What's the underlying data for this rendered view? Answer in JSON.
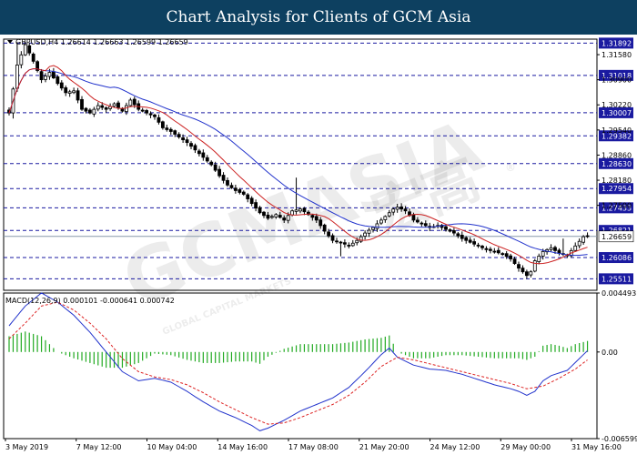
{
  "title": "Chart Analysis for Clients of GCM Asia",
  "watermark": {
    "main": "GCMASIA",
    "tag": "GLOBAL CAPITAL MARKETS",
    "chinese": "宏高",
    "trade": "®"
  },
  "colors": {
    "banner": "#0d4060",
    "candle": "#000000",
    "ma_fast": "#cc2222",
    "ma_slow": "#2233cc",
    "support_resistance": "#1a1aa0",
    "current_price_line": "#8899aa",
    "macd_hist": "#22aa22",
    "macd_main": "#2233cc",
    "macd_signal": "#dd2222"
  },
  "chart_data": [
    {
      "type": "candlestick",
      "info": "GBPUSD,H4  1.26614 1.26663 1.26599 1.26659",
      "ylim": [
        1.252,
        1.32
      ],
      "y_ticks": [
        "1.31892",
        "1.31580",
        "1.30900",
        "1.31018",
        "1.30220",
        "1.30007",
        "1.29540",
        "1.29382",
        "1.28860",
        "1.28630",
        "1.28180",
        "1.27954",
        "1.27500",
        "1.27433",
        "1.26821",
        "1.26659",
        "1.26086",
        "1.25511"
      ],
      "levels": [
        {
          "value": 1.31892,
          "label": "1.31892"
        },
        {
          "value": 1.31018,
          "label": "1.31018"
        },
        {
          "value": 1.30007,
          "label": "1.30007"
        },
        {
          "value": 1.29382,
          "label": "1.29382"
        },
        {
          "value": 1.2863,
          "label": "1.28630"
        },
        {
          "value": 1.27954,
          "label": "1.27954"
        },
        {
          "value": 1.27433,
          "label": "1.27433"
        },
        {
          "value": 1.26821,
          "label": "1.26821"
        },
        {
          "value": 1.26086,
          "label": "1.26086"
        },
        {
          "value": 1.25511,
          "label": "1.25511"
        }
      ],
      "plain_ticks": [
        {
          "value": 1.3158,
          "label": "1.31580"
        },
        {
          "value": 1.309,
          "label": "1.30900"
        },
        {
          "value": 1.3022,
          "label": "1.30220"
        },
        {
          "value": 1.2954,
          "label": "1.29540"
        },
        {
          "value": 1.2886,
          "label": "1.28860"
        },
        {
          "value": 1.2818,
          "label": "1.28180"
        },
        {
          "value": 1.275,
          "label": "1.27500"
        }
      ],
      "current_price": {
        "value": 1.26659,
        "label": "1.26659"
      },
      "x_labels": [
        "3 May 2019",
        "7 May 12:00",
        "10 May 04:00",
        "14 May 16:00",
        "17 May 08:00",
        "21 May 20:00",
        "24 May 12:00",
        "29 May 00:00",
        "31 May 16:00"
      ],
      "close_anchors": [
        [
          0,
          1.3
        ],
        [
          2,
          1.313
        ],
        [
          4,
          1.3185
        ],
        [
          6,
          1.314
        ],
        [
          8,
          1.309
        ],
        [
          10,
          1.311
        ],
        [
          12,
          1.308
        ],
        [
          14,
          1.3055
        ],
        [
          16,
          1.306
        ],
        [
          18,
          1.301
        ],
        [
          20,
          1.3
        ],
        [
          22,
          1.302
        ],
        [
          24,
          1.301
        ],
        [
          26,
          1.3025
        ],
        [
          28,
          1.3005
        ],
        [
          30,
          1.3035
        ],
        [
          32,
          1.301
        ],
        [
          34,
          1.3
        ],
        [
          36,
          1.299
        ],
        [
          38,
          1.296
        ],
        [
          40,
          1.295
        ],
        [
          42,
          1.2935
        ],
        [
          44,
          1.292
        ],
        [
          46,
          1.29
        ],
        [
          48,
          1.288
        ],
        [
          50,
          1.286
        ],
        [
          52,
          1.283
        ],
        [
          54,
          1.2805
        ],
        [
          56,
          1.279
        ],
        [
          58,
          1.278
        ],
        [
          60,
          1.2755
        ],
        [
          62,
          1.273
        ],
        [
          64,
          1.2715
        ],
        [
          66,
          1.2725
        ],
        [
          68,
          1.271
        ],
        [
          70,
          1.2735
        ],
        [
          72,
          1.274
        ],
        [
          74,
          1.2725
        ],
        [
          76,
          1.271
        ],
        [
          78,
          1.268
        ],
        [
          80,
          1.2655
        ],
        [
          82,
          1.265
        ],
        [
          84,
          1.264
        ],
        [
          86,
          1.2655
        ],
        [
          88,
          1.2675
        ],
        [
          90,
          1.269
        ],
        [
          92,
          1.271
        ],
        [
          94,
          1.273
        ],
        [
          95,
          1.274
        ],
        [
          96,
          1.2745
        ],
        [
          98,
          1.2735
        ],
        [
          100,
          1.271
        ],
        [
          102,
          1.27
        ],
        [
          104,
          1.269
        ],
        [
          106,
          1.2695
        ],
        [
          108,
          1.2685
        ],
        [
          110,
          1.2675
        ],
        [
          112,
          1.266
        ],
        [
          114,
          1.265
        ],
        [
          116,
          1.264
        ],
        [
          118,
          1.263
        ],
        [
          120,
          1.2625
        ],
        [
          122,
          1.2618
        ],
        [
          124,
          1.2605
        ],
        [
          126,
          1.258
        ],
        [
          128,
          1.256
        ],
        [
          129,
          1.257
        ],
        [
          130,
          1.26
        ],
        [
          132,
          1.2625
        ],
        [
          134,
          1.2635
        ],
        [
          136,
          1.262
        ],
        [
          138,
          1.2615
        ],
        [
          140,
          1.264
        ],
        [
          142,
          1.2665
        ],
        [
          143,
          1.2666
        ]
      ],
      "high_spikes": [
        [
          2,
          1.3192
        ],
        [
          71,
          1.2825
        ],
        [
          137,
          1.266
        ]
      ],
      "low_spikes": [
        [
          1,
          1.2985
        ],
        [
          82,
          1.2612
        ],
        [
          128,
          1.2551
        ],
        [
          129,
          1.2555
        ]
      ]
    },
    {
      "type": "macd",
      "info": "MACD(12,26,9) 0.000101 -0.000641 0.000742",
      "ylim": [
        -0.006599,
        0.004493
      ],
      "y_ticks": [
        "0.004493",
        "0.00",
        "-0.006599"
      ],
      "main_anchors": [
        [
          0,
          0.002
        ],
        [
          4,
          0.0035
        ],
        [
          8,
          0.0045
        ],
        [
          12,
          0.0038
        ],
        [
          16,
          0.0028
        ],
        [
          20,
          0.0015
        ],
        [
          24,
          0.0
        ],
        [
          28,
          -0.0015
        ],
        [
          32,
          -0.0022
        ],
        [
          36,
          -0.002
        ],
        [
          40,
          -0.0023
        ],
        [
          44,
          -0.003
        ],
        [
          48,
          -0.0038
        ],
        [
          52,
          -0.0045
        ],
        [
          56,
          -0.005
        ],
        [
          60,
          -0.0056
        ],
        [
          62,
          -0.006
        ],
        [
          64,
          -0.0058
        ],
        [
          68,
          -0.0052
        ],
        [
          72,
          -0.0045
        ],
        [
          76,
          -0.004
        ],
        [
          80,
          -0.0035
        ],
        [
          84,
          -0.0027
        ],
        [
          88,
          -0.0015
        ],
        [
          92,
          -0.0002
        ],
        [
          94,
          0.0003
        ],
        [
          96,
          -0.0004
        ],
        [
          100,
          -0.001
        ],
        [
          104,
          -0.0013
        ],
        [
          108,
          -0.0014
        ],
        [
          112,
          -0.0017
        ],
        [
          116,
          -0.0021
        ],
        [
          120,
          -0.0025
        ],
        [
          124,
          -0.0028
        ],
        [
          126,
          -0.003
        ],
        [
          128,
          -0.0033
        ],
        [
          130,
          -0.003
        ],
        [
          132,
          -0.0022
        ],
        [
          134,
          -0.0018
        ],
        [
          136,
          -0.0016
        ],
        [
          138,
          -0.0014
        ],
        [
          140,
          -0.0008
        ],
        [
          143,
          0.0001
        ]
      ],
      "signal_anchors": [
        [
          0,
          0.001
        ],
        [
          4,
          0.0022
        ],
        [
          8,
          0.0035
        ],
        [
          12,
          0.0038
        ],
        [
          16,
          0.0032
        ],
        [
          20,
          0.0022
        ],
        [
          24,
          0.001
        ],
        [
          28,
          -0.0005
        ],
        [
          32,
          -0.0015
        ],
        [
          36,
          -0.0019
        ],
        [
          40,
          -0.0021
        ],
        [
          44,
          -0.0025
        ],
        [
          48,
          -0.0031
        ],
        [
          52,
          -0.0038
        ],
        [
          56,
          -0.0044
        ],
        [
          60,
          -0.005
        ],
        [
          64,
          -0.0055
        ],
        [
          68,
          -0.0054
        ],
        [
          72,
          -0.005
        ],
        [
          76,
          -0.0045
        ],
        [
          80,
          -0.004
        ],
        [
          84,
          -0.0033
        ],
        [
          88,
          -0.0023
        ],
        [
          92,
          -0.0011
        ],
        [
          96,
          -0.0004
        ],
        [
          100,
          -0.0006
        ],
        [
          104,
          -0.0009
        ],
        [
          108,
          -0.0012
        ],
        [
          112,
          -0.0015
        ],
        [
          116,
          -0.0018
        ],
        [
          120,
          -0.0021
        ],
        [
          124,
          -0.0024
        ],
        [
          128,
          -0.0028
        ],
        [
          132,
          -0.0026
        ],
        [
          136,
          -0.002
        ],
        [
          140,
          -0.0013
        ],
        [
          143,
          -0.0006
        ]
      ]
    }
  ]
}
